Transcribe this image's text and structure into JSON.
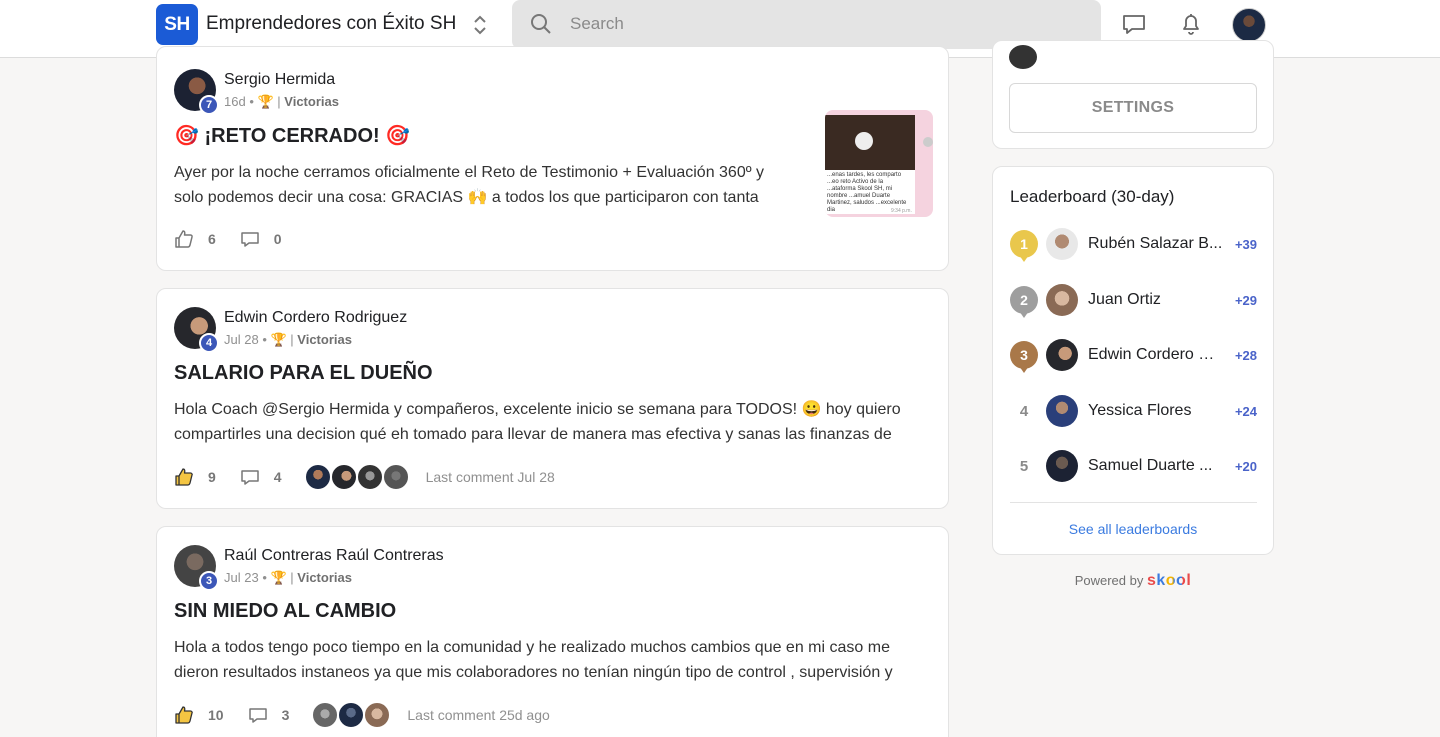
{
  "header": {
    "logo_text": "SH",
    "group_name": "Emprendedores con Éxito SH",
    "search_placeholder": "Search"
  },
  "posts": [
    {
      "author": "Sergio Hermida",
      "level": "7",
      "date": "16d",
      "category": "Victorias",
      "title": "¡RETO CERRADO!",
      "body": "Ayer por la noche cerramos oficialmente el Reto de Testimonio + Evaluación 360º y solo podemos decir una cosa: GRACIAS 🙌 a todos los que participaron con tanta",
      "likes": "6",
      "comments": "0",
      "last_comment": "",
      "thumbnail_text": "...enas tardes, les comparto ...eo reto Activo de la ...ataforma Skool SH, mi nombre ...amuel Duarte Martinez, saludos ...excelente dia",
      "thumbnail_time": "9:34 p.m."
    },
    {
      "author": "Edwin Cordero Rodriguez",
      "level": "4",
      "date": "Jul 28",
      "category": "Victorias",
      "title": "SALARIO PARA EL DUEÑO",
      "body": "Hola Coach @Sergio Hermida y compañeros, excelente inicio se semana para TODOS! 😀 hoy quiero compartirles una decision qué eh tomado para llevar de manera mas efectiva y sanas las finanzas de",
      "likes": "9",
      "comments": "4",
      "last_comment": "Last comment Jul 28"
    },
    {
      "author": "Raúl Contreras Raúl Contreras",
      "level": "3",
      "date": "Jul 23",
      "category": "Victorias",
      "title": "SIN MIEDO AL CAMBIO",
      "body": "Hola a todos tengo poco tiempo en la comunidad y he realizado muchos cambios que en mi caso me dieron resultados instaneos ya que mis colaboradores no tenían ningún tipo de control , supervisión y",
      "likes": "10",
      "comments": "3",
      "last_comment": "Last comment 25d ago"
    }
  ],
  "sidebar": {
    "settings_label": "SETTINGS",
    "leaderboard_title": "Leaderboard (30-day)",
    "leaders": [
      {
        "rank": "1",
        "name": "Rubén Salazar B...",
        "points": "+39",
        "medal_color": "#e9c74c"
      },
      {
        "rank": "2",
        "name": "Juan Ortiz",
        "points": "+29",
        "medal_color": "#9e9e9e"
      },
      {
        "rank": "3",
        "name": "Edwin Cordero R...",
        "points": "+28",
        "medal_color": "#a97849"
      },
      {
        "rank": "4",
        "name": "Yessica Flores",
        "points": "+24"
      },
      {
        "rank": "5",
        "name": "Samuel Duarte ...",
        "points": "+20"
      }
    ],
    "see_all": "See all leaderboards",
    "powered_by": "Powered by",
    "brand": "skool"
  },
  "colors": {
    "accent": "#1b5bd6",
    "level_badge": "#3c57b8",
    "points": "#4a63c9",
    "link": "#3b7be0"
  }
}
